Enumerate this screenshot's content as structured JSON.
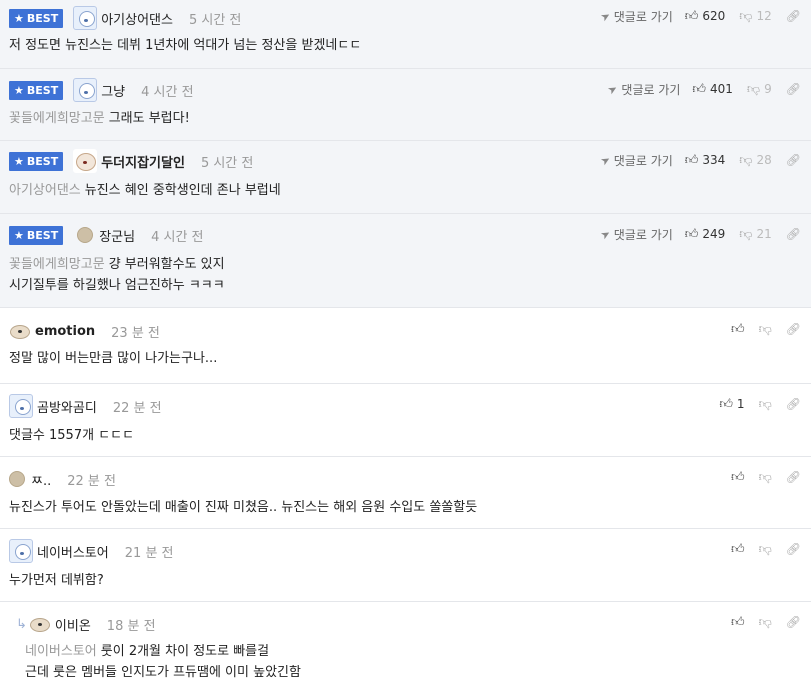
{
  "best_label": "BEST",
  "reply_label": "댓글로 가기",
  "comments": [
    {
      "nick": "아기상어댄스",
      "time": "5 시간 전",
      "body": "저 정도면 뉴진스는 데뷔 1년차에 억대가 넘는 정산을 받겠네ㄷㄷ",
      "likes": "620",
      "dislikes": "12"
    },
    {
      "nick": "그냥",
      "time": "4 시간 전",
      "mention": "꽃들에게희망고문",
      "body": "그래도 부럽다!",
      "likes": "401",
      "dislikes": "9"
    },
    {
      "nick": "두더지잡기달인",
      "time": "5 시간 전",
      "mention": "아기상어댄스",
      "body": "뉴진스 혜인 중학생인데 존나 부럽네",
      "likes": "334",
      "dislikes": "28"
    },
    {
      "nick": "장군님",
      "time": "4 시간 전",
      "mention": "꽃들에게희망고문",
      "body": "걍 부러워할수도 있지",
      "body2": "시기질투를 하길했나 엄근진하누 ㅋㅋㅋ",
      "likes": "249",
      "dislikes": "21"
    },
    {
      "nick": "emotion",
      "time": "23 분 전",
      "body": "정말 많이 버는만큼 많이 나가는구나..."
    },
    {
      "nick": "곰방와곰디",
      "time": "22 분 전",
      "body": "댓글수 1557개 ㄷㄷㄷ",
      "likes": "1"
    },
    {
      "nick": "ㅉ..",
      "time": "22 분 전",
      "body": "뉴진스가 투어도 안돌았는데 매출이 진짜 미쳤음.. 뉴진스는 해외 음원 수입도 쏠쏠할듯"
    },
    {
      "nick": "네이버스토어",
      "time": "21 분 전",
      "body": "누가먼저 데뷔함?"
    },
    {
      "nick": "이비온",
      "time": "18 분 전",
      "mention": "네이버스토어",
      "body": "룻이 2개월 차이 정도로 빠를걸",
      "body2": "근데 룻은 멤버들 인지도가 프듀땜에 이미 높았긴함"
    }
  ]
}
